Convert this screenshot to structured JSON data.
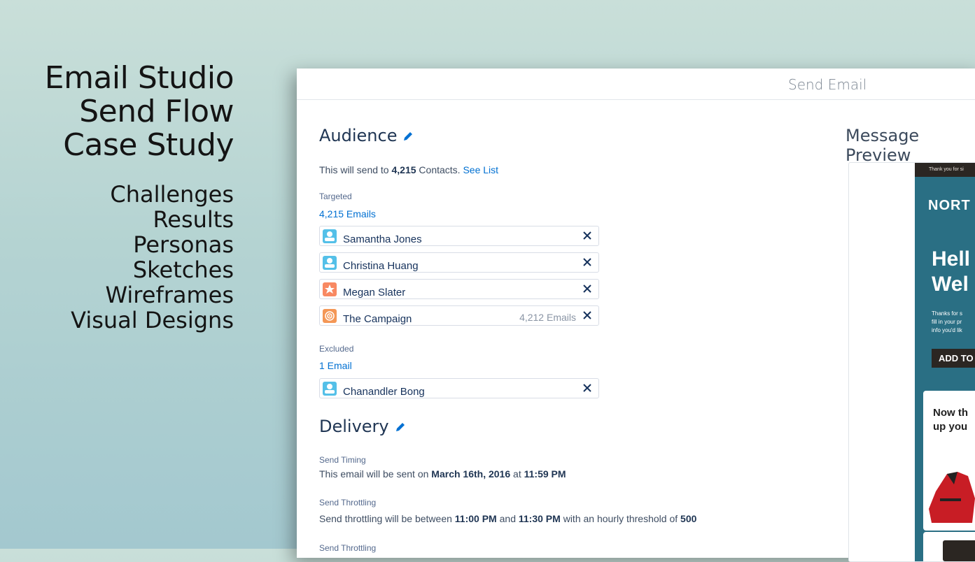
{
  "sidebar": {
    "title_lines": [
      "Email Studio",
      "Send Flow",
      "Case Study"
    ],
    "links": [
      "Challenges",
      "Results",
      "Personas",
      "Sketches",
      "Wireframes",
      "Visual Designs"
    ]
  },
  "window": {
    "title": "Send Email",
    "audience": {
      "heading": "Audience",
      "summary_prefix": "This will send to ",
      "summary_count": "4,215",
      "summary_suffix": " Contacts. ",
      "see_list": "See List",
      "targeted_label": "Targeted",
      "targeted_count": "4,215 Emails",
      "targeted": [
        {
          "name": "Samantha Jones",
          "icon": "contact-icon",
          "color": "#54c0e8",
          "meta": ""
        },
        {
          "name": "Christina Huang",
          "icon": "contact-icon",
          "color": "#54c0e8",
          "meta": ""
        },
        {
          "name": "Megan Slater",
          "icon": "lead-icon",
          "color": "#f88962",
          "meta": ""
        },
        {
          "name": "The Campaign",
          "icon": "campaign-icon",
          "color": "#f49756",
          "meta": "4,212 Emails"
        }
      ],
      "excluded_label": "Excluded",
      "excluded_count": "1 Email",
      "excluded": [
        {
          "name": "Chanandler Bong",
          "icon": "contact-icon",
          "color": "#54c0e8",
          "meta": ""
        }
      ]
    },
    "delivery": {
      "heading": "Delivery",
      "timing_label": "Send Timing",
      "timing_prefix": "This email will be sent on ",
      "timing_date": "March 16th, 2016",
      "timing_mid": " at ",
      "timing_time": "11:59 PM",
      "throttling_label": "Send Throttling",
      "throttling_prefix": "Send throttling will be between ",
      "throttling_start": "11:00 PM",
      "throttling_mid": " and ",
      "throttling_end": "11:30 PM",
      "throttling_mid2": " with an hourly threshold of ",
      "throttling_threshold": "500",
      "throttling_label_2": "Send Throttling"
    },
    "preview": {
      "heading": "Message Preview",
      "topbar": "Thank you for si",
      "brand": "NORT",
      "hero_lines": [
        "Hell",
        "Wel"
      ],
      "body_lines": [
        "Thanks for s",
        "fill in your pr",
        "info you'd lik"
      ],
      "cta": "ADD TO",
      "card_lines": [
        "Now th",
        "up you"
      ]
    }
  },
  "colors": {
    "accent": "#0070d2",
    "heading": "#1f3553",
    "email_bg": "#2a6f84",
    "email_dark": "#2b2622"
  }
}
